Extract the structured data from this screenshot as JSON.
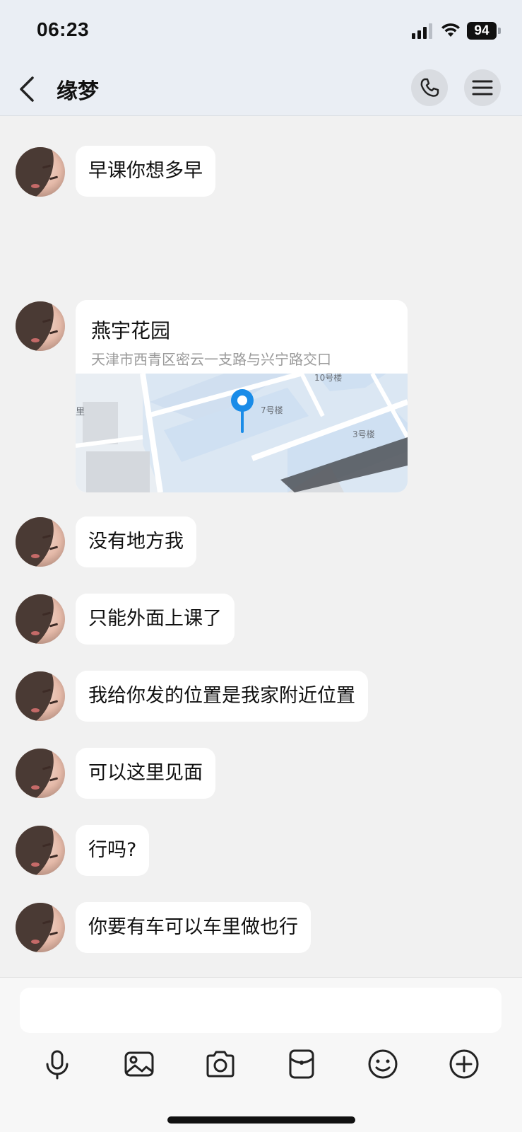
{
  "status_bar": {
    "time": "06:23",
    "battery": "94",
    "icons": [
      "signal-icon",
      "wifi-icon",
      "battery-icon"
    ]
  },
  "header": {
    "title": "缘梦",
    "back_icon": "chevron-left-icon",
    "call_icon": "phone-icon",
    "menu_icon": "menu-icon"
  },
  "messages": [
    {
      "text": "早课你想多早"
    },
    {
      "location": {
        "name": "燕宇花园",
        "address": "天津市西青区密云一支路与兴宁路交口",
        "map_labels": [
          "10号楼",
          "7号楼",
          "3号楼",
          "里"
        ]
      }
    },
    {
      "text": "没有地方我"
    },
    {
      "text": "只能外面上课了"
    },
    {
      "text": "我给你发的位置是我家附近位置"
    },
    {
      "text": "可以这里见面"
    },
    {
      "text": "行吗?"
    },
    {
      "text": "你要有车可以车里做也行"
    }
  ],
  "composer": {
    "placeholder": "",
    "tools": [
      "microphone-icon",
      "image-icon",
      "camera-icon",
      "red-packet-icon",
      "emoji-icon",
      "plus-icon"
    ]
  },
  "colors": {
    "background": "#f1f1f1",
    "header": "#eaeef4",
    "bubble": "#ffffff",
    "map_pin": "#1a8ce8"
  }
}
